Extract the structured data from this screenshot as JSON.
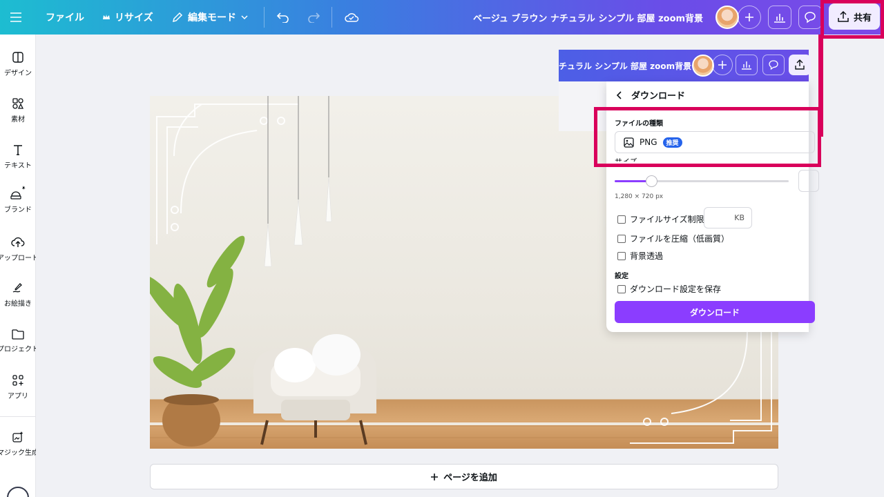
{
  "topbar": {
    "menu_icon": "hamburger-icon",
    "file_label": "ファイル",
    "resize_label": "リサイズ",
    "edit_mode_label": "編集モード",
    "doc_title": "ベージュ ブラウン ナチュラル シンプル 部屋 zoom背景",
    "share_label": "共有"
  },
  "sidebar": {
    "items": [
      {
        "label": "デザイン",
        "icon": "layout-icon"
      },
      {
        "label": "素材",
        "icon": "shapes-icon"
      },
      {
        "label": "テキスト",
        "icon": "text-icon"
      },
      {
        "label": "ブランド",
        "icon": "brand-icon"
      },
      {
        "label": "アップロード",
        "icon": "upload-cloud-icon"
      },
      {
        "label": "お絵描き",
        "icon": "draw-icon"
      },
      {
        "label": "プロジェクト",
        "icon": "folder-icon"
      },
      {
        "label": "アプリ",
        "icon": "apps-icon"
      },
      {
        "label": "マジック生成",
        "icon": "magic-icon"
      }
    ]
  },
  "canvas": {
    "add_page_label": "ページを追加"
  },
  "float_bar": {
    "title_fragment": "チュラル シンプル 部屋 zoom背景"
  },
  "download_panel": {
    "title": "ダウンロード",
    "file_type_label": "ファイルの種類",
    "file_type_value": "PNG",
    "recommended_badge": "推奨",
    "size_label": "サイズ",
    "size_slider_fraction": 0.21,
    "dimensions": "1,280 × 720 px",
    "option_filesize_limit": "ファイルサイズ制限",
    "kb_unit": "KB",
    "option_compress": "ファイルを圧縮（低画質）",
    "option_transparent": "背景透過",
    "settings_label": "設定",
    "option_save_settings": "ダウンロード設定を保存",
    "download_button": "ダウンロード"
  },
  "colors": {
    "accent": "#8b3dff",
    "highlight": "#d9005b",
    "badge": "#2563eb"
  }
}
